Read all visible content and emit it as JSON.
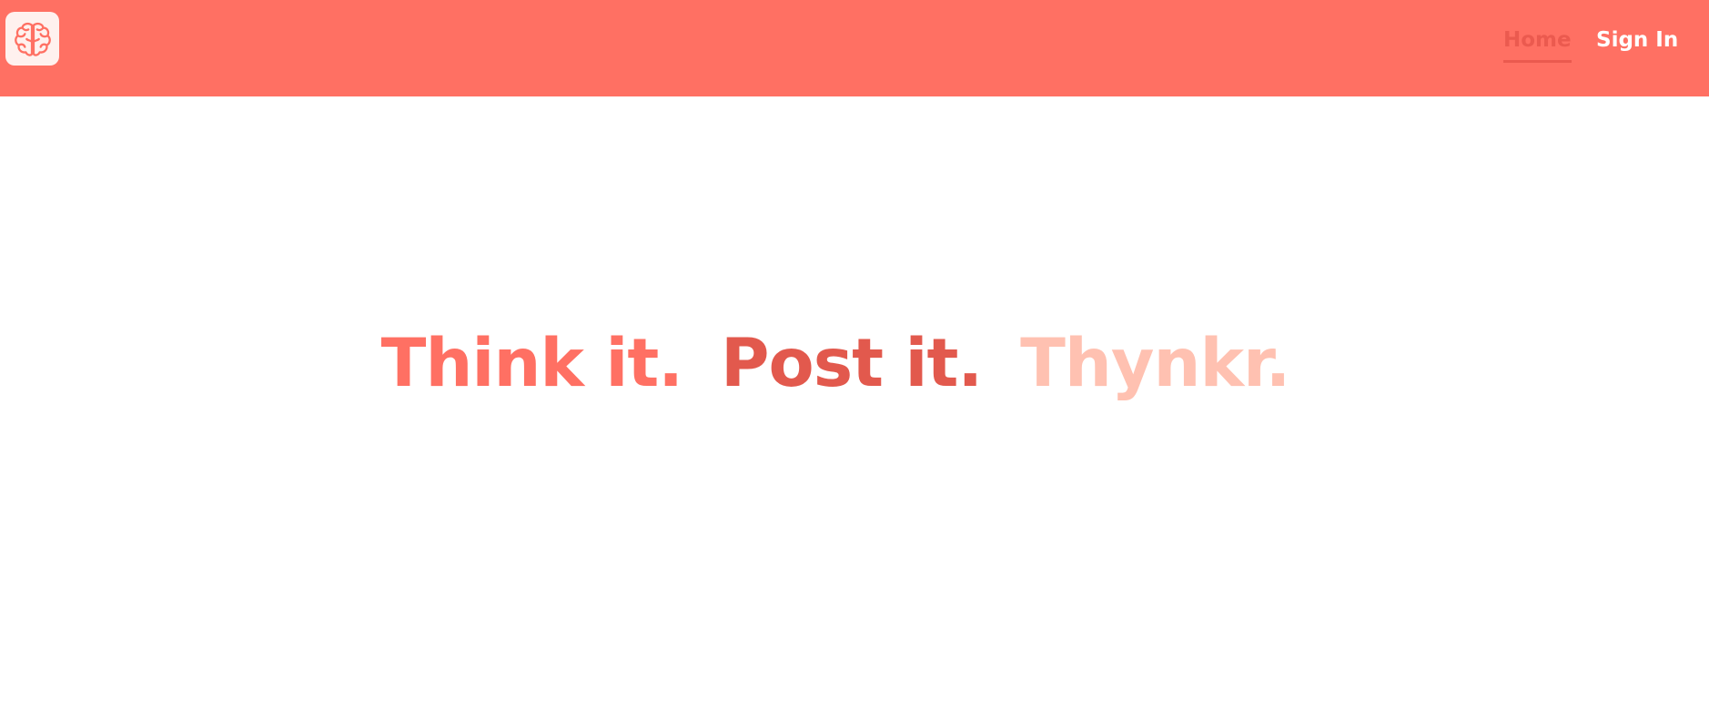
{
  "navbar": {
    "logo_icon": "brain-icon",
    "links": [
      {
        "label": "Home",
        "active": true
      },
      {
        "label": "Sign In",
        "active": false
      }
    ]
  },
  "hero": {
    "word1": "Think it.",
    "word2": "Post it.",
    "word3": "Thynkr."
  },
  "colors": {
    "navbar_bg": "#ff7063",
    "primary": "#ff7063",
    "dark": "#e2594d",
    "light": "#ffc1b1"
  }
}
